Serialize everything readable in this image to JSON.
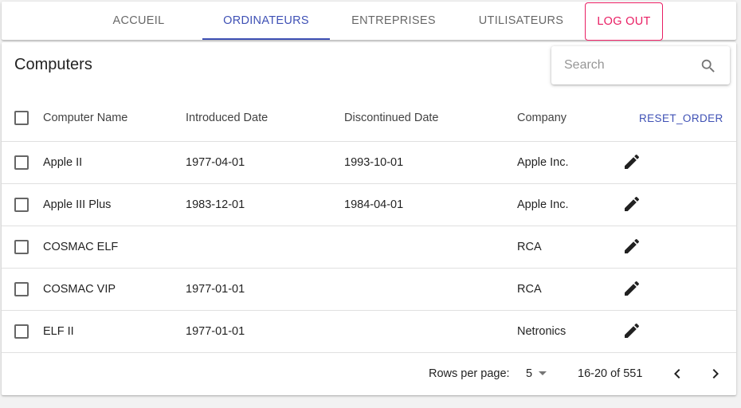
{
  "nav": {
    "tabs": [
      {
        "label": "ACCUEIL"
      },
      {
        "label": "ORDINATEURS",
        "active": true
      },
      {
        "label": "ENTREPRISES"
      },
      {
        "label": "UTILISATEURS"
      }
    ],
    "logout_label": "LOG OUT"
  },
  "colors": {
    "accent": "#3f51b5",
    "logout": "#e91e63"
  },
  "page": {
    "title": "Computers",
    "search": {
      "placeholder": "Search",
      "value": "",
      "icon": "search-icon"
    }
  },
  "table": {
    "columns": {
      "name": "Computer Name",
      "introduced": "Introduced Date",
      "discontinued": "Discontinued Date",
      "company": "Company"
    },
    "reset_label": "RESET_ORDER",
    "rows": [
      {
        "name": "Apple II",
        "introduced": "1977-04-01",
        "discontinued": "1993-10-01",
        "company": "Apple Inc.",
        "icon": "edit-icon"
      },
      {
        "name": "Apple III Plus",
        "introduced": "1983-12-01",
        "discontinued": "1984-04-01",
        "company": "Apple Inc.",
        "icon": "edit-icon"
      },
      {
        "name": "COSMAC ELF",
        "introduced": "",
        "discontinued": "",
        "company": "RCA",
        "icon": "edit-icon"
      },
      {
        "name": "COSMAC VIP",
        "introduced": "1977-01-01",
        "discontinued": "",
        "company": "RCA",
        "icon": "edit-icon"
      },
      {
        "name": "ELF II",
        "introduced": "1977-01-01",
        "discontinued": "",
        "company": "Netronics",
        "icon": "edit-icon"
      }
    ]
  },
  "pagination": {
    "rows_per_page_label": "Rows per page:",
    "rows_per_page": "5",
    "range": "16-20 of 551"
  }
}
